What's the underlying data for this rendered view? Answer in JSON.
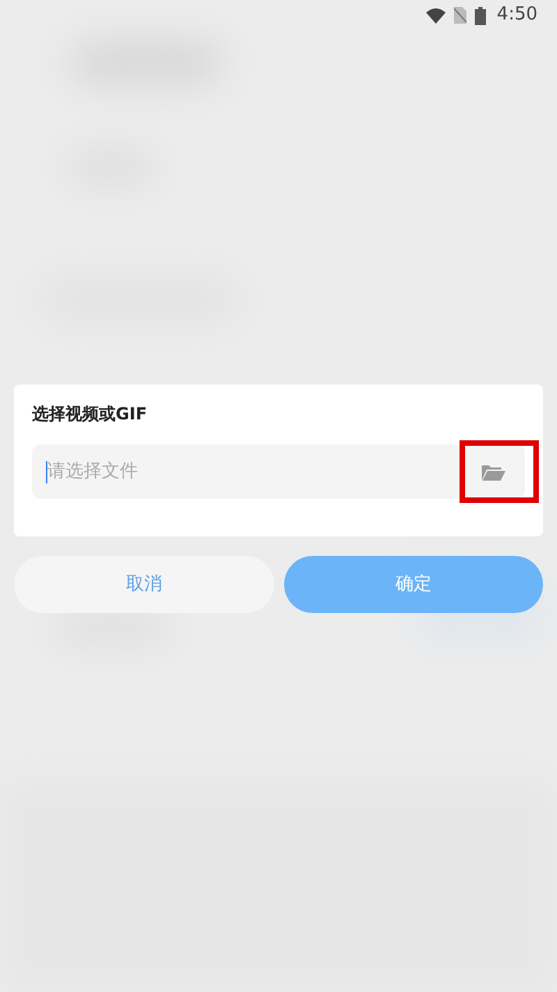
{
  "status_bar": {
    "time": "4:50"
  },
  "dialog": {
    "title": "选择视频或GIF",
    "file_field": {
      "placeholder": "请选择文件",
      "focused": true
    }
  },
  "buttons": [
    {
      "label": "取消",
      "kind": "secondary"
    },
    {
      "label": "确定",
      "kind": "primary"
    }
  ]
}
